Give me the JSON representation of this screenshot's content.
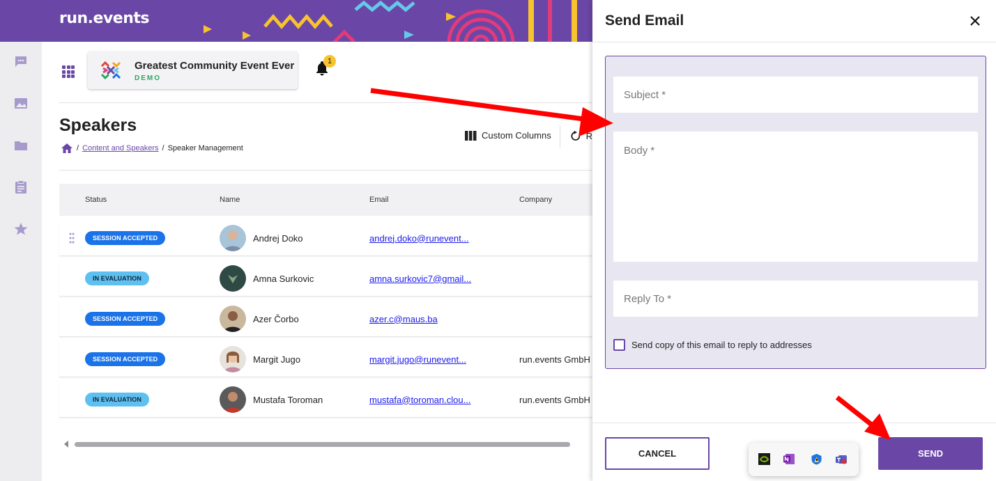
{
  "app": {
    "logo_text": "run.events"
  },
  "event": {
    "title": "Greatest Community Event Ever",
    "badge": "DEMO"
  },
  "notifications": {
    "count": "1"
  },
  "page": {
    "title": "Speakers",
    "breadcrumb": [
      "Content and Speakers",
      "Speaker Management"
    ],
    "separator": "/"
  },
  "toolbar": {
    "custom_columns": "Custom Columns",
    "refresh_label": "R"
  },
  "table": {
    "columns": [
      "Status",
      "Name",
      "Email",
      "Company"
    ],
    "rows": [
      {
        "status": "SESSION ACCEPTED",
        "status_kind": "accepted",
        "name": "Andrej Doko",
        "email": "andrej.doko@runevent...",
        "company": ""
      },
      {
        "status": "IN EVALUATION",
        "status_kind": "evaluation",
        "name": "Amna Surkovic",
        "email": "amna.surkovic7@gmail...",
        "company": ""
      },
      {
        "status": "SESSION ACCEPTED",
        "status_kind": "accepted",
        "name": "Azer Čorbo",
        "email": "azer.c@maus.ba",
        "company": ""
      },
      {
        "status": "SESSION ACCEPTED",
        "status_kind": "accepted",
        "name": "Margit Jugo",
        "email": "margit.jugo@runevent...",
        "company": "run.events GmbH"
      },
      {
        "status": "IN EVALUATION",
        "status_kind": "evaluation",
        "name": "Mustafa Toroman",
        "email": "mustafa@toroman.clou...",
        "company": "run.events GmbH"
      }
    ]
  },
  "sidebar": {
    "icons": [
      "chat-icon",
      "image-icon",
      "folder-icon",
      "clipboard-icon",
      "star-icon"
    ]
  },
  "dialog": {
    "title": "Send Email",
    "subject_placeholder": "Subject *",
    "body_placeholder": "Body *",
    "reply_to_placeholder": "Reply To *",
    "copy_checkbox_label": "Send copy of this email to reply to addresses",
    "cancel_label": "CANCEL",
    "send_label": "SEND"
  },
  "taskbar_popup": {
    "icons": [
      "nvidia-icon",
      "onenote-icon",
      "defender-icon",
      "teams-icon"
    ]
  },
  "colors": {
    "brand": "#6a46a6",
    "accepted": "#1a73e8",
    "evaluation": "#5ec0f0",
    "annotation": "#ff0000"
  }
}
